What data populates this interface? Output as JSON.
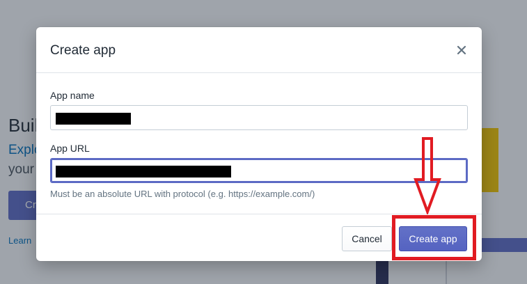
{
  "background": {
    "heading": "Buil",
    "link": "Explo",
    "text": "your",
    "button_label": "Cr",
    "learn": "Learn"
  },
  "modal": {
    "title": "Create app",
    "fields": {
      "app_name": {
        "label": "App name",
        "value": "[redacted]"
      },
      "app_url": {
        "label": "App URL",
        "value": "[redacted]",
        "help": "Must be an absolute URL with protocol (e.g. https://example.com/)"
      }
    },
    "footer": {
      "cancel_label": "Cancel",
      "create_label": "Create app"
    }
  },
  "colors": {
    "primary": "#5c6ac4",
    "annotation": "#e11b22",
    "text": "#212b36",
    "muted": "#637381"
  },
  "icons": {
    "close": "close-icon",
    "annotation_arrow": "down-arrow-icon"
  }
}
